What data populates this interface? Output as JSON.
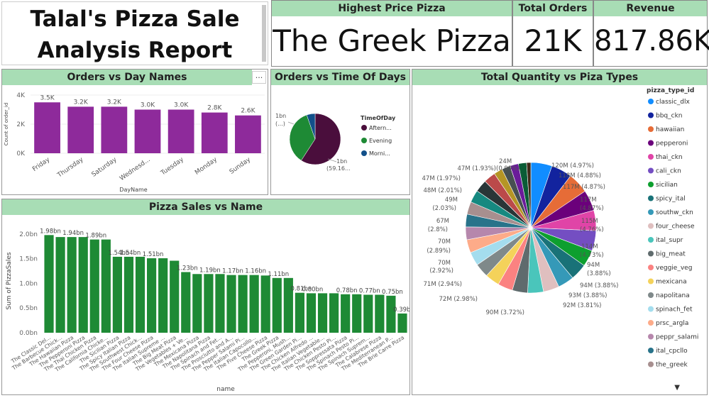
{
  "report_title_line1": "Talal's Pizza Sale",
  "report_title_line2": "Analysis Report",
  "kpis": {
    "highest_price_label": "Highest Price Pizza",
    "highest_price_value": "The Greek Pizza",
    "total_orders_label": "Total Orders",
    "total_orders_value": "21K",
    "revenue_label": "Revenue",
    "revenue_value": "817.86K"
  },
  "more_options": "···",
  "chart_data": [
    {
      "id": "orders_vs_day",
      "type": "bar",
      "title": "Orders vs Day Names",
      "xlabel": "DayName",
      "ylabel": "Count of order_id",
      "categories": [
        "Friday",
        "Thursday",
        "Saturday",
        "Wednesd...",
        "Tuesday",
        "Monday",
        "Sunday"
      ],
      "values": [
        3500,
        3200,
        3200,
        3000,
        3000,
        2800,
        2600
      ],
      "labels": [
        "3.5K",
        "3.2K",
        "3.2K",
        "3.0K",
        "3.0K",
        "2.8K",
        "2.6K"
      ],
      "yticks": [
        "0K",
        "2K",
        "4K"
      ],
      "ylim": [
        0,
        4000
      ],
      "color": "#8e2a9b"
    },
    {
      "id": "orders_vs_time",
      "type": "pie",
      "title": "Orders vs Time Of Days",
      "legend_title": "TimeOfDay",
      "labels": [
        "Aftern...",
        "Evening",
        "Morni..."
      ],
      "values": [
        59.16,
        35.5,
        5.34
      ],
      "colors": [
        "#4a0e3c",
        "#1e8a35",
        "#12508a"
      ],
      "data_labels": [
        "1bn (59.16...",
        "1bn (...)"
      ]
    },
    {
      "id": "pizza_sales_vs_name",
      "type": "bar",
      "title": "Pizza Sales vs Name",
      "xlabel": "name",
      "ylabel": "Sum of PizzaSales",
      "yticks": [
        "0.0bn",
        "0.5bn",
        "1.0bn",
        "1.5bn",
        "2.0bn"
      ],
      "ylim": [
        0,
        2.1
      ],
      "categories": [
        "The Classic Del...",
        "The Barbecue Chick...",
        "The Hawaiian Pizza",
        "The Pepperoni Pizza",
        "The Thai Chicken Pizza",
        "The California Chicke...",
        "The Sicilian Pizza",
        "The Spicy Italian Pizza",
        "The Southwest Chick...",
        "The Four Cheese Pizza",
        "The Italian Supreme ...",
        "The Big Meat Pizza",
        "The Vegetables + Ve...",
        "The Mexicana Pizza",
        "The Napolitana Pizza",
        "The Spinach and Fet...",
        "The Prosciutto and A...",
        "The Pepper Salami Pi...",
        "The Italian Capocollo...",
        "The Five Cheese Pizza",
        "The Greek Pizza",
        "The Pepperoni, Mush...",
        "The Green Garden Pi...",
        "The Chicken Alfredo ...",
        "The Italian Vegetable...",
        "The Chicken Pesto Pi...",
        "The Soppressata Pizza",
        "The Spinach Pesto Pi...",
        "The Spinach Suprem...",
        "The Calabrese Pizza",
        "The Mediterranean P...",
        "The Brie Carre Pizza"
      ],
      "values": [
        1.98,
        1.94,
        1.94,
        1.94,
        1.89,
        1.89,
        1.54,
        1.54,
        1.54,
        1.51,
        1.51,
        1.46,
        1.23,
        1.19,
        1.19,
        1.19,
        1.17,
        1.17,
        1.17,
        1.16,
        1.11,
        1.11,
        0.81,
        0.8,
        0.8,
        0.8,
        0.78,
        0.78,
        0.77,
        0.77,
        0.75,
        0.39
      ],
      "labels": [
        "1.98bn",
        "",
        "1.94bn",
        "",
        "1.89bn",
        "",
        "1.54bn",
        "1.54bn",
        "",
        "1.51bn",
        "",
        "",
        "1.23bn",
        "",
        "1.19bn",
        "",
        "1.17bn",
        "",
        "1.16bn",
        "",
        "1.11bn",
        "",
        "0.81bn",
        "0.80bn",
        "",
        "",
        "0.78bn",
        "",
        "0.77bn",
        "",
        "0.75bn",
        "0.39bn"
      ],
      "color": "#1e8a35"
    },
    {
      "id": "qty_vs_type",
      "type": "pie",
      "title": "Total Quantity vs Piza Types",
      "legend_title": "pizza_type_id",
      "labels": [
        "classic_dlx",
        "bbq_ckn",
        "hawaiian",
        "pepperoni",
        "thai_ckn",
        "cali_ckn",
        "sicilian",
        "spicy_ital",
        "southw_ckn",
        "four_cheese",
        "ital_supr",
        "big_meat",
        "veggie_veg",
        "mexicana",
        "napolitana",
        "spinach_fet",
        "prsc_argla",
        "peppr_salami",
        "ital_cpcllo",
        "the_greek"
      ],
      "colors": [
        "#118dff",
        "#12239e",
        "#e66c37",
        "#6b007b",
        "#e044a7",
        "#744ec2",
        "#0d9f2f",
        "#197278",
        "#3599b8",
        "#dfbfbf",
        "#4ac5bb",
        "#5f6b6d",
        "#fb8281",
        "#f4d25a",
        "#7f898a",
        "#a4ddee",
        "#fdab89",
        "#b687ac",
        "#28738a",
        "#a78f8f"
      ],
      "slice_values": [
        4.97,
        4.88,
        4.87,
        4.87,
        4.76,
        4.73,
        3.88,
        3.88,
        3.81,
        3.72,
        3.7,
        3.6,
        3.5,
        3.4,
        3.3,
        3.2,
        3.1,
        3.0,
        2.98,
        2.94,
        2.92,
        2.89,
        2.8,
        2.03,
        2.01,
        1.97,
        1.93,
        0.99
      ],
      "slice_colors": [
        "#118dff",
        "#12239e",
        "#e66c37",
        "#6b007b",
        "#e044a7",
        "#744ec2",
        "#0d9f2f",
        "#197278",
        "#3599b8",
        "#dfbfbf",
        "#4ac5bb",
        "#5f6b6d",
        "#fb8281",
        "#f4d25a",
        "#7f898a",
        "#a4ddee",
        "#fdab89",
        "#b687ac",
        "#28738a",
        "#a78f8f",
        "#168980",
        "#293537",
        "#bb4a4a",
        "#b59525",
        "#475052",
        "#6a1b9a",
        "#0a5c36",
        "#3e2a1a"
      ],
      "data_labels": [
        "120M (4.97%)",
        "118M (4.88%)",
        "117M (4.87%)",
        "117M",
        "(4.87%)",
        "115M",
        "(4.76%)",
        "114M",
        "(4.73%)",
        "94M",
        "(3.88%)",
        "94M (3.88%)",
        "93M (3.88%)",
        "92M (3.81%)",
        "90M (3.72%)",
        "72M (2.98%)",
        "71M (2.94%)",
        "70M",
        "(2.92%)",
        "70M",
        "(2.89%)",
        "67M",
        "(2.8%)",
        "49M",
        "(2.03%)",
        "48M (2.01%)",
        "47M (1.97%)",
        "47M (1.93%)",
        "24M",
        "(0.99%)"
      ]
    }
  ]
}
